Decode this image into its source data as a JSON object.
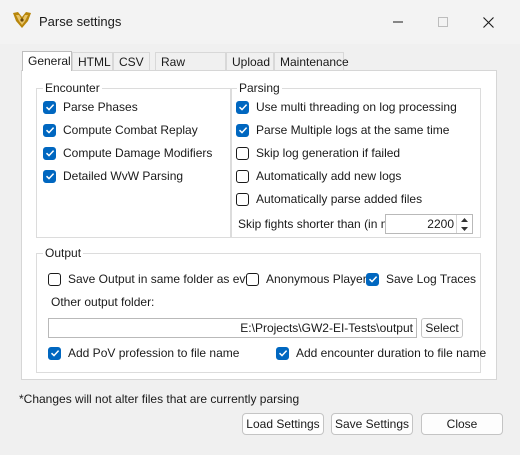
{
  "window": {
    "title": "Parse settings"
  },
  "tabs": [
    "General",
    "HTML",
    "CSV",
    "Raw formats",
    "Upload",
    "Maintenance"
  ],
  "encounter": {
    "title": "Encounter",
    "items": [
      {
        "label": "Parse Phases",
        "checked": true
      },
      {
        "label": "Compute Combat Replay",
        "checked": true
      },
      {
        "label": "Compute Damage Modifiers",
        "checked": true
      },
      {
        "label": "Detailed WvW Parsing",
        "checked": true
      }
    ]
  },
  "parsing": {
    "title": "Parsing",
    "items": [
      {
        "label": "Use multi threading on log processing",
        "checked": true
      },
      {
        "label": "Parse Multiple logs at the same time",
        "checked": true
      },
      {
        "label": "Skip log generation if failed",
        "checked": false
      },
      {
        "label": "Automatically add new logs",
        "checked": false
      },
      {
        "label": "Automatically parse added files",
        "checked": false
      }
    ],
    "skip_label": "Skip fights shorter than (in ms):",
    "skip_value": "2200"
  },
  "output": {
    "title": "Output",
    "save_same_folder": {
      "label": "Save Output in same folder as evtc",
      "checked": false
    },
    "anonymous": {
      "label": "Anonymous Players",
      "checked": false
    },
    "save_traces": {
      "label": "Save Log Traces",
      "checked": true
    },
    "other_folder_label": "Other output folder:",
    "folder_value": "E:\\Projects\\GW2-EI-Tests\\output",
    "select_label": "Select",
    "add_pov": {
      "label": "Add PoV profession to file name",
      "checked": true
    },
    "add_duration": {
      "label": "Add encounter duration to file name",
      "checked": true
    }
  },
  "footer": {
    "note": "*Changes will not alter files that are currently parsing",
    "load": "Load Settings",
    "save": "Save Settings",
    "close": "Close"
  },
  "colors": {
    "accent": "#0067c0"
  }
}
